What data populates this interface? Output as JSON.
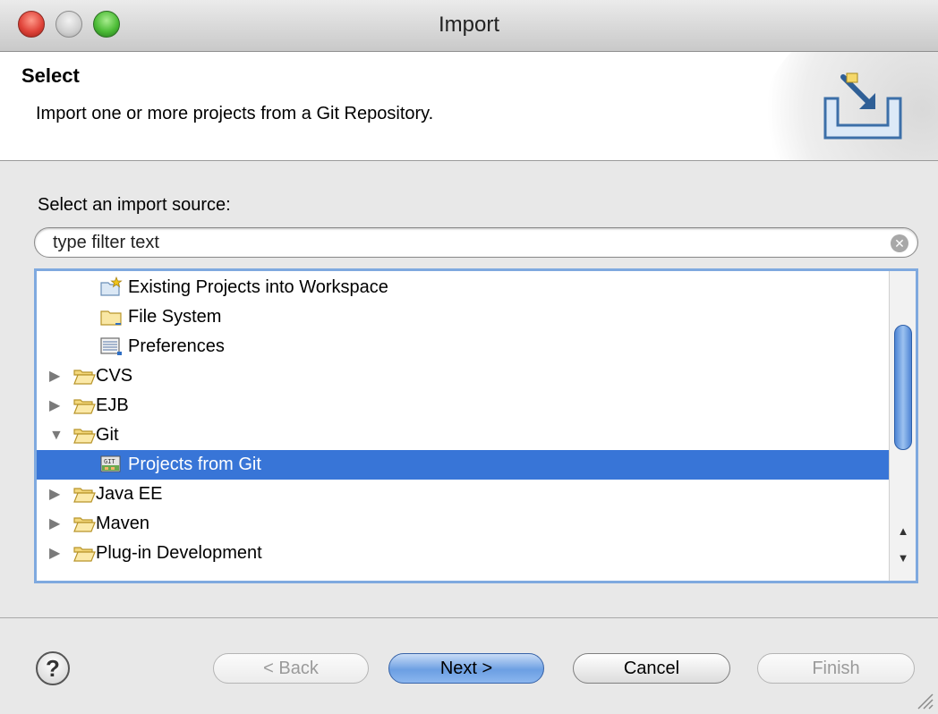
{
  "window": {
    "title": "Import"
  },
  "header": {
    "title": "Select",
    "description": "Import one or more projects from a Git Repository."
  },
  "body": {
    "prompt": "Select an import source:",
    "filter_placeholder": "type filter text"
  },
  "tree": {
    "items": [
      {
        "label": "Existing Projects into Workspace",
        "icon": "existing-projects-icon",
        "level": 1,
        "expandable": false,
        "selected": false
      },
      {
        "label": "File System",
        "icon": "folder-icon",
        "level": 1,
        "expandable": false,
        "selected": false
      },
      {
        "label": "Preferences",
        "icon": "preferences-icon",
        "level": 1,
        "expandable": false,
        "selected": false
      },
      {
        "label": "CVS",
        "icon": "folder-open-icon",
        "level": 0,
        "expandable": true,
        "expanded": false,
        "selected": false
      },
      {
        "label": "EJB",
        "icon": "folder-open-icon",
        "level": 0,
        "expandable": true,
        "expanded": false,
        "selected": false
      },
      {
        "label": "Git",
        "icon": "folder-open-icon",
        "level": 0,
        "expandable": true,
        "expanded": true,
        "selected": false
      },
      {
        "label": "Projects from Git",
        "icon": "git-projects-icon",
        "level": 1,
        "expandable": false,
        "selected": true
      },
      {
        "label": "Java EE",
        "icon": "folder-open-icon",
        "level": 0,
        "expandable": true,
        "expanded": false,
        "selected": false
      },
      {
        "label": "Maven",
        "icon": "folder-open-icon",
        "level": 0,
        "expandable": true,
        "expanded": false,
        "selected": false
      },
      {
        "label": "Plug-in Development",
        "icon": "folder-open-icon",
        "level": 0,
        "expandable": true,
        "expanded": false,
        "selected": false
      }
    ]
  },
  "buttons": {
    "help": "?",
    "back": "< Back",
    "next": "Next >",
    "cancel": "Cancel",
    "finish": "Finish"
  },
  "colors": {
    "selection": "#3875d7",
    "tree_border": "#7fa9df",
    "default_button": "#6c9fe3"
  }
}
